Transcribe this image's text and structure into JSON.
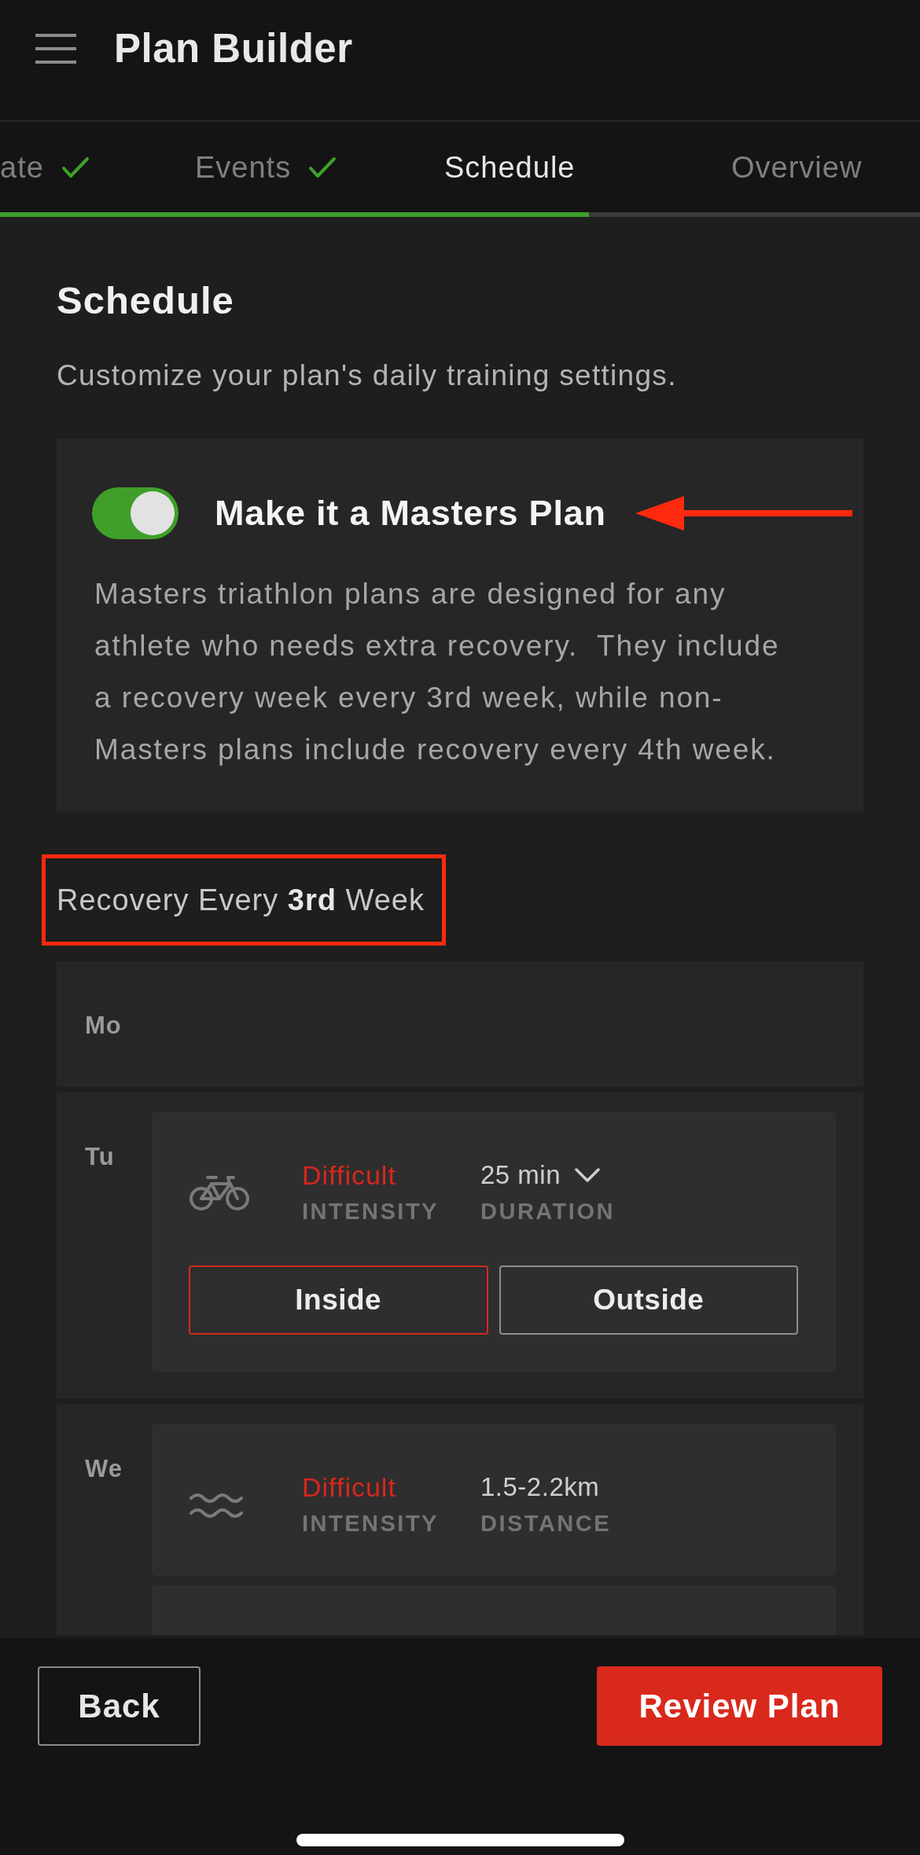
{
  "header": {
    "title": "Plan Builder"
  },
  "tabs": [
    {
      "label": "ate",
      "completed": true,
      "selected": false
    },
    {
      "label": "Events",
      "completed": true,
      "selected": false
    },
    {
      "label": "Schedule",
      "completed": false,
      "selected": true
    },
    {
      "label": "Overview",
      "completed": false,
      "selected": false
    }
  ],
  "progress": {
    "level": 0.64
  },
  "section": {
    "title": "Schedule",
    "subtitle": "Customize your plan's daily training settings."
  },
  "masters": {
    "label": "Make it a Masters Plan",
    "on": true,
    "description": "Masters triathlon plans are designed for any athlete who needs extra recovery.  They include a recovery week every 3rd week, while non-Masters plans include recovery every 4th week."
  },
  "recovery_label": "Recovery Every **3rd** Week",
  "days": [
    {
      "day": "Mo"
    },
    {
      "day": "Tu",
      "workouts": [
        {
          "kind": "bike",
          "intensity": "Difficult",
          "intensity_label": "INTENSITY",
          "measure": "25 min",
          "measure_label": "DURATION",
          "dropdown": true,
          "locations": [
            {
              "label": "Inside",
              "selected": true
            },
            {
              "label": "Outside",
              "selected": false
            }
          ]
        }
      ]
    },
    {
      "day": "We",
      "workouts": [
        {
          "kind": "swim",
          "intensity": "Difficult",
          "intensity_label": "INTENSITY",
          "measure": "1.5-2.2km",
          "measure_label": "DISTANCE"
        },
        {
          "kind": "partial"
        }
      ]
    }
  ],
  "footer": {
    "buttons": [
      {
        "label": "Back",
        "kind": "secondary"
      },
      {
        "label": "Review Plan",
        "kind": "primary"
      }
    ]
  }
}
